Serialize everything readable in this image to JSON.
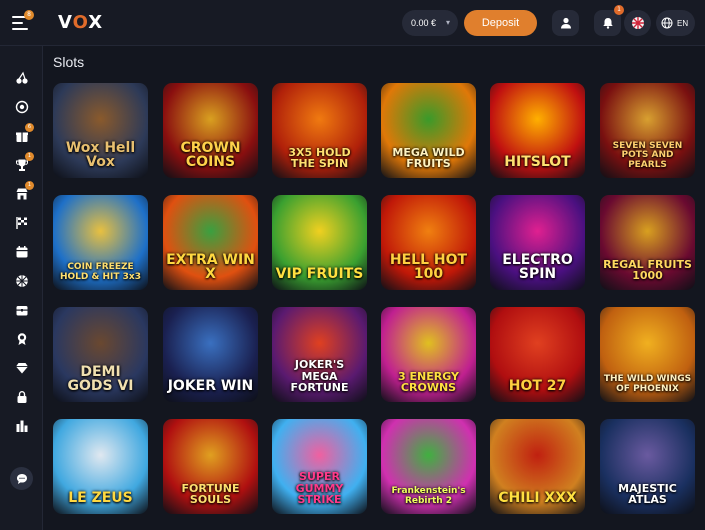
{
  "header": {
    "menu_badge": "8",
    "logo_v": "V",
    "logo_o": "O",
    "logo_x": "X",
    "balance": "0.00 €",
    "deposit_label": "Deposit",
    "notification_badge": "1",
    "language": "EN"
  },
  "sidebar": {
    "badges": {
      "gift": "6",
      "trophy": "1",
      "store": "1"
    }
  },
  "main": {
    "section_title": "Slots",
    "games": [
      {
        "name": "Wox Hell Vox",
        "bg": "#2d3a58",
        "accent": "#8a5a2c",
        "color": "#e8c070"
      },
      {
        "name": "CROWN COINS",
        "bg": "#8a0f0f",
        "accent": "#d9a020",
        "color": "#ffd24a"
      },
      {
        "name": "3X5 HOLD THE SPIN",
        "bg": "#b0200a",
        "accent": "#f07a10",
        "color": "#ffe070"
      },
      {
        "name": "MEGA WILD FRUITS",
        "bg": "#e07808",
        "accent": "#3a9a2a",
        "color": "#fff3c0"
      },
      {
        "name": "HITSLOT",
        "bg": "#c01010",
        "accent": "#ffb000",
        "color": "#ffe070"
      },
      {
        "name": "SEVEN SEVEN POTS AND PEARLS",
        "bg": "#7a1010",
        "accent": "#d8a030",
        "color": "#ffd070"
      },
      {
        "name": "COIN FREEZE HOLD & HIT 3x3",
        "bg": "#1e70c8",
        "accent": "#e8c040",
        "color": "#ffe070"
      },
      {
        "name": "EXTRA WIN X",
        "bg": "#e05010",
        "accent": "#3aa040",
        "color": "#ffd840"
      },
      {
        "name": "VIP FRUITS",
        "bg": "#3aa030",
        "accent": "#f0d020",
        "color": "#ffe040"
      },
      {
        "name": "HELL HOT 100",
        "bg": "#c01808",
        "accent": "#f08010",
        "color": "#ffd040"
      },
      {
        "name": "ELECTRO SPIN",
        "bg": "#4a1080",
        "accent": "#e02090",
        "color": "#ffffff"
      },
      {
        "name": "REGAL FRUITS 1000",
        "bg": "#6a0a30",
        "accent": "#d8a020",
        "color": "#ffd860"
      },
      {
        "name": "DEMI GODS VI",
        "bg": "#2a3860",
        "accent": "#6a4830",
        "color": "#f0e0b0"
      },
      {
        "name": "JOKER WIN",
        "bg": "#1a2050",
        "accent": "#3a70c0",
        "color": "#ffffff"
      },
      {
        "name": "JOKER'S MEGA FORTUNE",
        "bg": "#5a1a70",
        "accent": "#e04020",
        "color": "#ffffff"
      },
      {
        "name": "3 ENERGY CROWNS",
        "bg": "#c02090",
        "accent": "#e0c020",
        "color": "#ffe040"
      },
      {
        "name": "HOT 27",
        "bg": "#b00e10",
        "accent": "#e04020",
        "color": "#ffd040"
      },
      {
        "name": "THE WILD WINGS OF PHOENIX",
        "bg": "#c06010",
        "accent": "#f0b020",
        "color": "#fff0c0"
      },
      {
        "name": "LE ZEUS",
        "bg": "#40a8e0",
        "accent": "#e0e8f0",
        "color": "#ffd840"
      },
      {
        "name": "FORTUNE SOULS",
        "bg": "#b01010",
        "accent": "#e0a020",
        "color": "#ffe070"
      },
      {
        "name": "SUPER GUMMY STRIKE",
        "bg": "#40b0f0",
        "accent": "#f060a0",
        "color": "#ff3a8a"
      },
      {
        "name": "Frankenstein's Rebirth 2",
        "bg": "#d030b0",
        "accent": "#40b040",
        "color": "#f0ff60"
      },
      {
        "name": "CHILI XXX",
        "bg": "#d08020",
        "accent": "#c02010",
        "color": "#ffe040"
      },
      {
        "name": "MAJESTIC ATLAS",
        "bg": "#1a3060",
        "accent": "#6a5aa0",
        "color": "#ffffff"
      }
    ]
  }
}
